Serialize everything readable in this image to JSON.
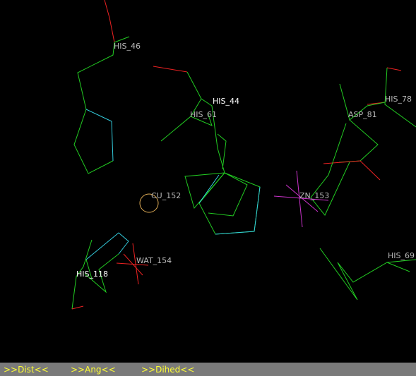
{
  "viewer": {
    "labels": {
      "his46": "HIS_46",
      "his44": "HIS_44",
      "his61": "HIS_61",
      "his78": "HIS_78",
      "asp81": "ASP_81",
      "cu152": "CU_152",
      "zn153": "ZN_153",
      "wat154": "WAT_154",
      "his118": "HIS_118",
      "his69": "HIS_69"
    },
    "colors": {
      "background": "#000000",
      "carbon": "#22cc22",
      "nitrogen": "#33ccdd",
      "oxygen": "#ee2222",
      "zinc": "#cc33cc",
      "copper": "#ddaa55",
      "label_grey": "#b8b8b8",
      "label_white": "#ffffff"
    }
  },
  "toolbar": {
    "dist_label": ">>Dist<<",
    "ang_label": ">>Ang<<",
    "dihed_label": ">>Dihed<<",
    "text_color": "#ffff33",
    "bar_color": "#7a7a7a"
  }
}
